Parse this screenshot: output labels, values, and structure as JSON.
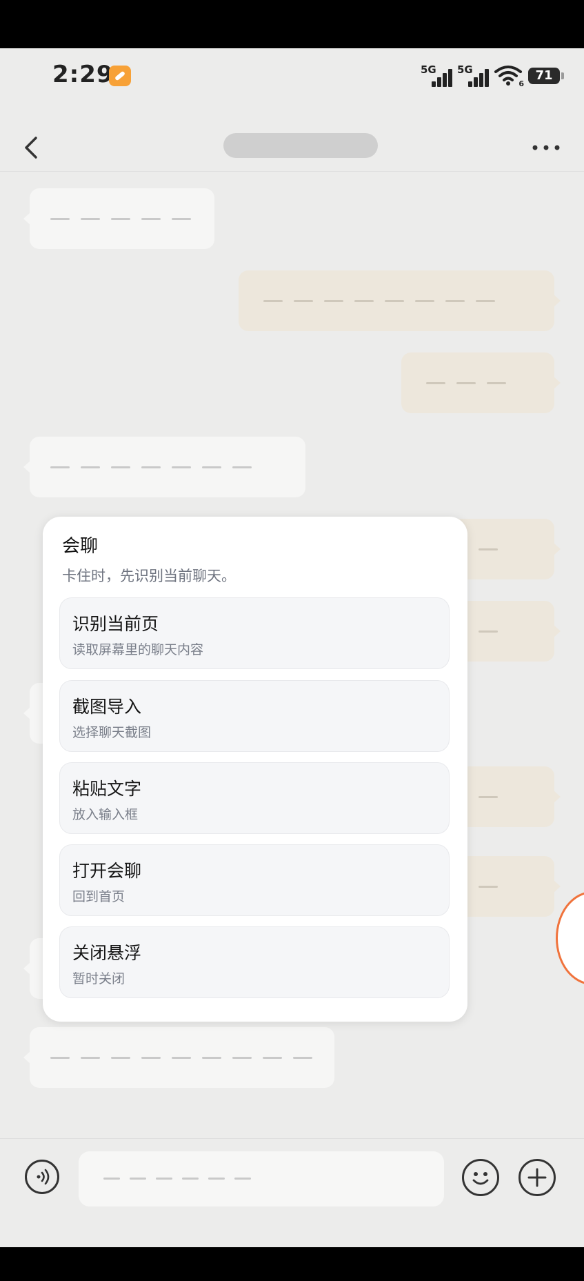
{
  "status_bar": {
    "time": "2:29",
    "signal_1_label": "5G",
    "signal_2_label": "5G",
    "wifi_badge": "6",
    "battery": "71"
  },
  "chat": {
    "bubbles": [
      {
        "side": "left",
        "dash_count": 5
      },
      {
        "side": "right",
        "dash_count": 8
      },
      {
        "side": "right",
        "dash_count": 3
      },
      {
        "side": "left",
        "dash_count": 7
      },
      {
        "side": "left",
        "dash_count": 9
      }
    ]
  },
  "popup": {
    "title": "会聊",
    "subtitle": "卡住时，先识别当前聊天。",
    "items": [
      {
        "title": "识别当前页",
        "subtitle": "读取屏幕里的聊天内容"
      },
      {
        "title": "截图导入",
        "subtitle": "选择聊天截图"
      },
      {
        "title": "粘贴文字",
        "subtitle": "放入输入框"
      },
      {
        "title": "打开会聊",
        "subtitle": "回到首页"
      },
      {
        "title": "关闭悬浮",
        "subtitle": "暂时关闭"
      }
    ]
  },
  "input": {
    "placeholder_dash_count": 6
  },
  "icons": {
    "back": "chevron-left-icon",
    "more": "more-dots-icon",
    "voice": "voice-icon",
    "emoji": "emoji-icon",
    "plus": "plus-icon",
    "app_badge": "app-notification-icon"
  },
  "colors": {
    "floating_ball_border": "#f0733c",
    "app_badge": "#f7a137"
  }
}
